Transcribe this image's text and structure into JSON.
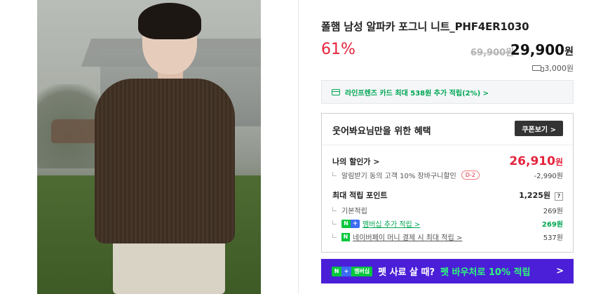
{
  "product": {
    "title": "폴햄 남성 알파카 포그니 니트_PHF4ER1030",
    "discount_rate": "61%",
    "original_price": "69,900원",
    "sale_price": "29,900",
    "sale_price_unit": "원",
    "shipping_fee": "3,000원"
  },
  "card_benefit": {
    "text": "라인프렌즈 카드 최대 538원 추가 적립(2%) >"
  },
  "benefit_box": {
    "title": "웃어봐요님만을 위한 혜택",
    "coupon_button": "쿠폰보기 >",
    "my_discount_label": "나의 할인가 >",
    "my_discount_price": "26,910",
    "my_discount_unit": "원",
    "alert_coupon_label": "알림받기 동의 고객 10% 장바구니할인",
    "alert_coupon_badge": "D-2",
    "alert_coupon_value": "-2,990원",
    "max_points_label": "최대 적립 포인트",
    "max_points_value": "1,225원",
    "help_icon_text": "?",
    "basic_points_label": "기본적립",
    "basic_points_value": "269원",
    "membership_label": "멤버십 추가 적립 >",
    "membership_value": "269원",
    "npay_label": "네이버페이 머니 결제 시 최대 적립 >",
    "npay_value": "537원"
  },
  "promo_banner": {
    "badge_n": "N",
    "badge_plus": "+",
    "badge_text": "멤버십",
    "text_before": "펫 사료 살 때?",
    "text_highlight": "펫 바우처로 10% 적립",
    "arrow": ">"
  },
  "icons": {
    "card": "credit-card-icon",
    "shipping": "truck-icon",
    "help": "question-icon",
    "npay": "naver-pay-icon",
    "membership": "naver-plus-icon"
  },
  "colors": {
    "discount_red": "#e4243d",
    "naver_green": "#00a651",
    "banner_purple": "#4b1fd8",
    "banner_highlight": "#2efc7a"
  }
}
